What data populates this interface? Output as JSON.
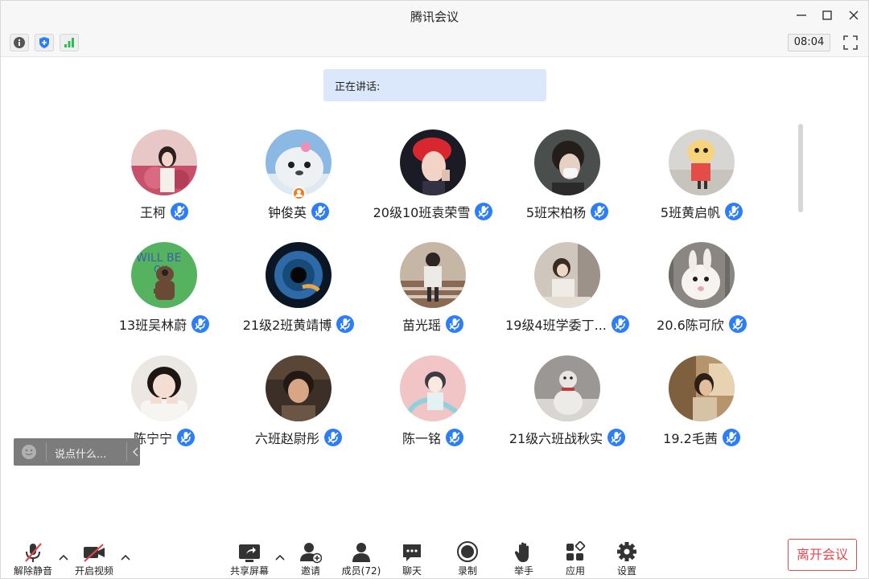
{
  "window": {
    "title": "腾讯会议"
  },
  "infobar": {
    "time": "08:04"
  },
  "speaking": {
    "label": "正在讲话:"
  },
  "chat": {
    "placeholder": "说点什么..."
  },
  "participants": [
    {
      "name": "王柯"
    },
    {
      "name": "钟俊英",
      "host": true
    },
    {
      "name": "20级10班袁荣雪"
    },
    {
      "name": "5班宋柏杨"
    },
    {
      "name": "5班黄启帆"
    },
    {
      "name": "13班吴林蔚"
    },
    {
      "name": "21级2班黄靖博"
    },
    {
      "name": "苗光瑶"
    },
    {
      "name": "19级4班学委丁..."
    },
    {
      "name": "20.6陈可欣"
    },
    {
      "name": "陈宁宁"
    },
    {
      "name": "六班赵尉彤"
    },
    {
      "name": "陈一铭"
    },
    {
      "name": "21级六班战秋实"
    },
    {
      "name": "19.2毛茜"
    }
  ],
  "toolbar": {
    "unmute": "解除静音",
    "video": "开启视频",
    "share": "共享屏幕",
    "invite": "邀请",
    "members": "成员(72)",
    "chat": "聊天",
    "record": "录制",
    "raise_hand": "举手",
    "apps": "应用",
    "settings": "设置",
    "leave": "离开会议"
  },
  "colors": {
    "accent": "#2c7ef8",
    "leave": "#e0494d",
    "speaking_bg": "#dbe8fb",
    "host_badge": "#f37b20"
  }
}
